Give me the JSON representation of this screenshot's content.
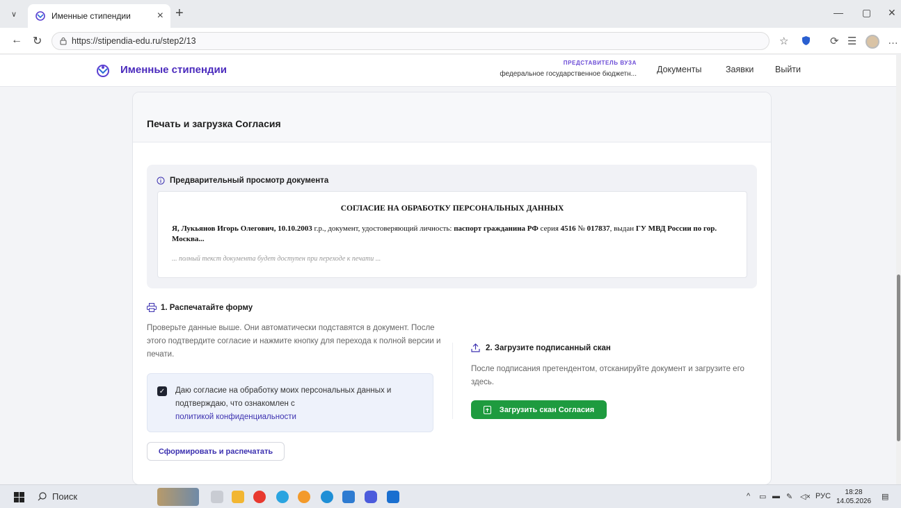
{
  "browser": {
    "tab_title": "Именные стипендии",
    "url": "https://stipendia-edu.ru/step2/13"
  },
  "header": {
    "brand": "Именные стипендии",
    "role_label": "ПРЕДСТАВИТЕЛЬ ВУЗА",
    "organization": "федеральное государственное бюджетн...",
    "nav": [
      "Документы",
      "Заявки",
      "Выйти"
    ]
  },
  "card": {
    "title": "Печать и загрузка Согласия",
    "preview": {
      "label": "Предварительный просмотр документа",
      "doc_title": "СОГЛАСИЕ НА ОБРАБОТКУ ПЕРСОНАЛЬНЫХ ДАННЫХ",
      "body_parts": {
        "p1": "Я, Лукьянов Игорь Олегович, 10.10.2003",
        "p2": " г.р., документ, удостоверяющий личность: ",
        "p3": "паспорт гражданина РФ",
        "p4": " серия ",
        "p5": "4516",
        "p6": " № ",
        "p7": "017837",
        "p8": ", выдан ",
        "p9": "ГУ МВД России по гор. Москва..."
      },
      "note": "... полный текст документа будет доступен при переходе к печати ..."
    },
    "step1": {
      "title": "1. Распечатайте форму",
      "text": "Проверьте данные выше. Они автоматически подставятся в документ. После этого подтвердите согласие и нажмите кнопку для перехода к полной версии и печати.",
      "consent_text": "Даю согласие на обработку моих персональных данных и подтверждаю, что ознакомлен с",
      "policy_link": "политикой конфиденциальности",
      "consent_checked": true,
      "button": "Сформировать и распечатать"
    },
    "step2": {
      "title": "2. Загрузите подписанный скан",
      "text": "После подписания претендентом, отсканируйте документ и загрузите его здесь.",
      "button": "Загрузить скан Согласия"
    }
  },
  "taskbar": {
    "search": "Поиск",
    "lang": "РУС",
    "time": "18:28",
    "date": "14.05.2026"
  },
  "colors": {
    "brand": "#4b2bbd",
    "link": "#3c31b0",
    "upload_button": "#1e9b3f"
  }
}
